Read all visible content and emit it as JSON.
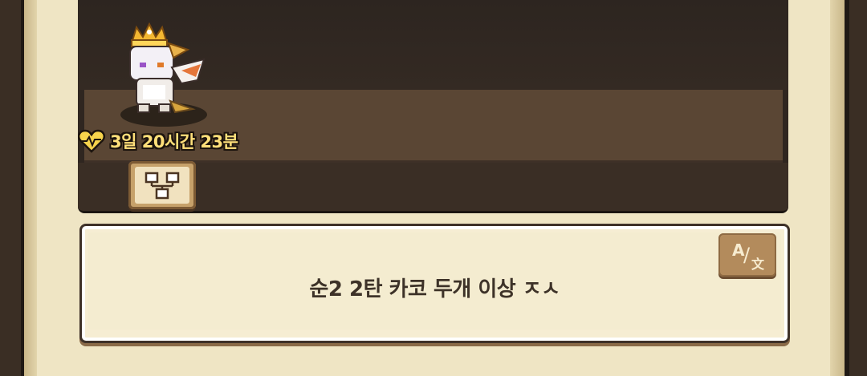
{
  "pet": {
    "timer": "3일 20시간 23분",
    "sprite_icon": "white-dragon-pet-with-gold-crown-icon"
  },
  "room_button": {
    "icon": "family-tree-icon"
  },
  "message": {
    "text": "순2 2탄 카코 두개 이상 ㅈㅅ"
  },
  "translate_button": {
    "icon": "translate-icon",
    "glyph_a": "A",
    "glyph_slash": "/",
    "glyph_wen": "文"
  },
  "colors": {
    "timer_text": "#ffe07a",
    "heart": "#f7d44c",
    "parchment": "#efe5c4",
    "room_floor": "#5a4634",
    "message_text": "#3d3228"
  }
}
